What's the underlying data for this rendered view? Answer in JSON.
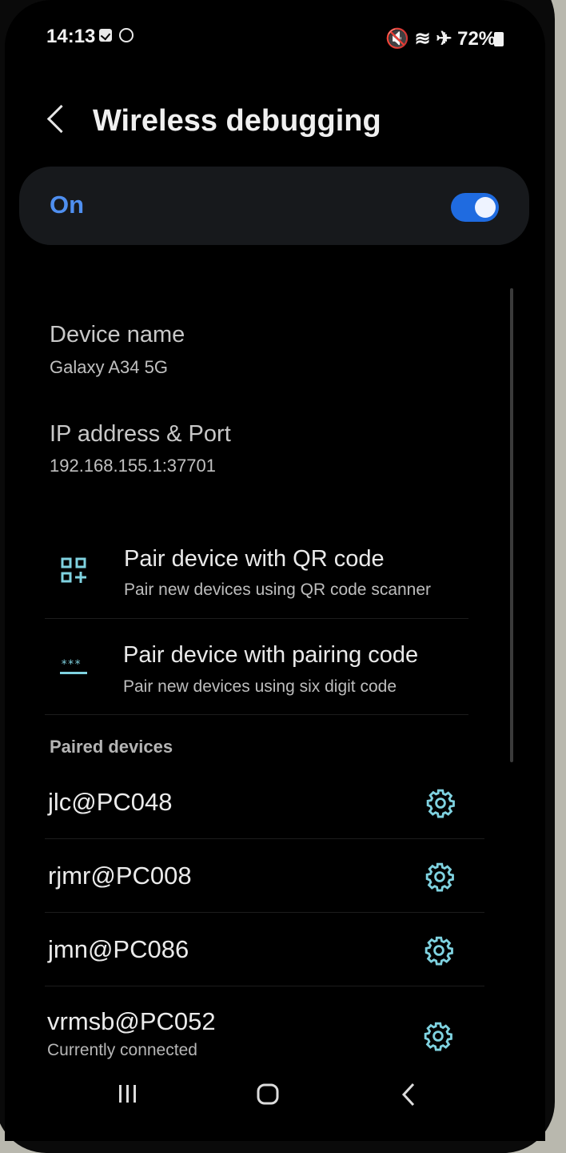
{
  "status_bar": {
    "time": "14:13",
    "right_text": "🔇 ≋ ✈ 72%",
    "battery": "72%"
  },
  "header": {
    "title": "Wireless debugging"
  },
  "toggle": {
    "label": "On",
    "state": "on",
    "accent": "#1f6be0"
  },
  "info": {
    "device_name_label": "Device name",
    "device_name_value": "Galaxy A34 5G",
    "ip_label": "IP address & Port",
    "ip_value": "192.168.155.1:37701"
  },
  "actions": [
    {
      "title": "Pair device with QR code",
      "subtitle": "Pair new devices using QR code scanner",
      "icon": "qr-code-icon"
    },
    {
      "title": "Pair device with pairing code",
      "subtitle": "Pair new devices using six digit code",
      "icon": "pin-code-icon"
    }
  ],
  "paired": {
    "section_label": "Paired devices",
    "devices": [
      {
        "name": "jlc@PC048",
        "status": ""
      },
      {
        "name": "rjmr@PC008",
        "status": ""
      },
      {
        "name": "jmn@PC086",
        "status": ""
      },
      {
        "name": "vrmsb@PC052",
        "status": "Currently connected"
      }
    ]
  },
  "nav": {
    "recents": "recents-icon",
    "home": "home-icon",
    "back": "back-icon"
  }
}
